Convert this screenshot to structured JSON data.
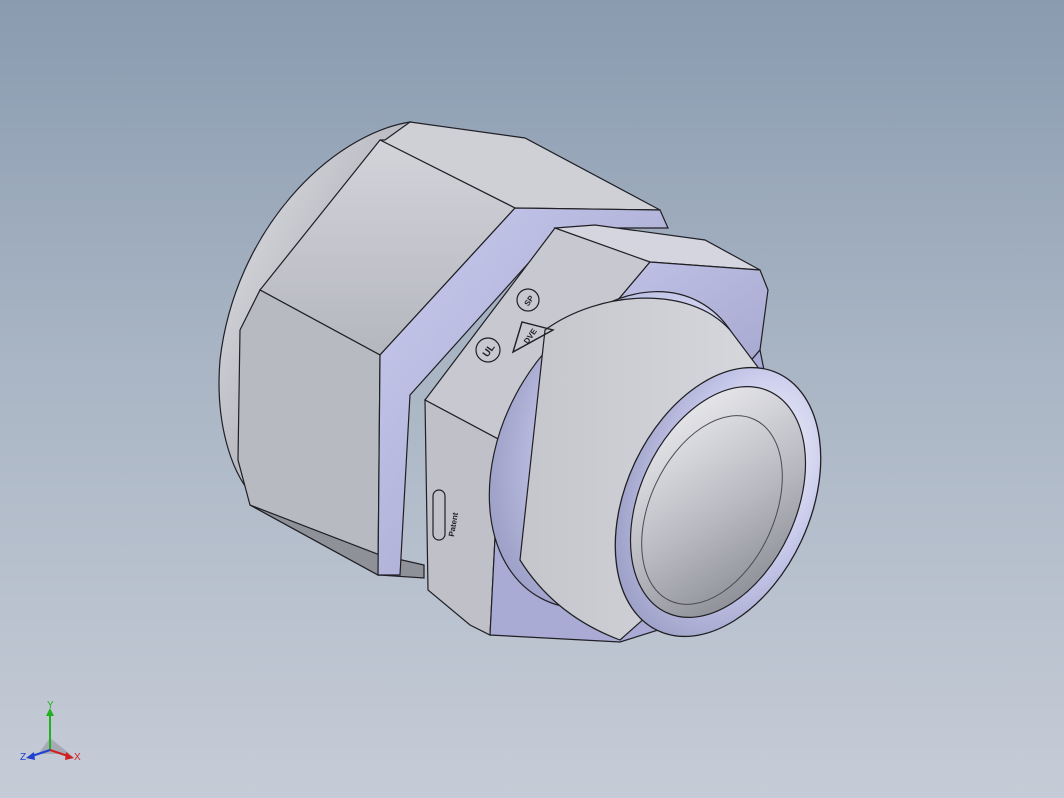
{
  "viewport": {
    "background_top": "#8a9bb0",
    "background_bottom": "#c6ccd7"
  },
  "model": {
    "markings": {
      "patent_text": "Patent",
      "ul_mark": "UL",
      "csa_mark": "SP",
      "triangle_mark": "DVE"
    },
    "colors": {
      "body": "#c4c6cf",
      "body_dark": "#9da0a8",
      "edge": "#1f1f24",
      "highlight": "#d9dbee",
      "accent_lavender": "#b9bbe0"
    }
  },
  "triad": {
    "x_label": "X",
    "y_label": "Y",
    "z_label": "Z",
    "x_color": "#d02020",
    "y_color": "#20b020",
    "z_color": "#2040d0"
  }
}
